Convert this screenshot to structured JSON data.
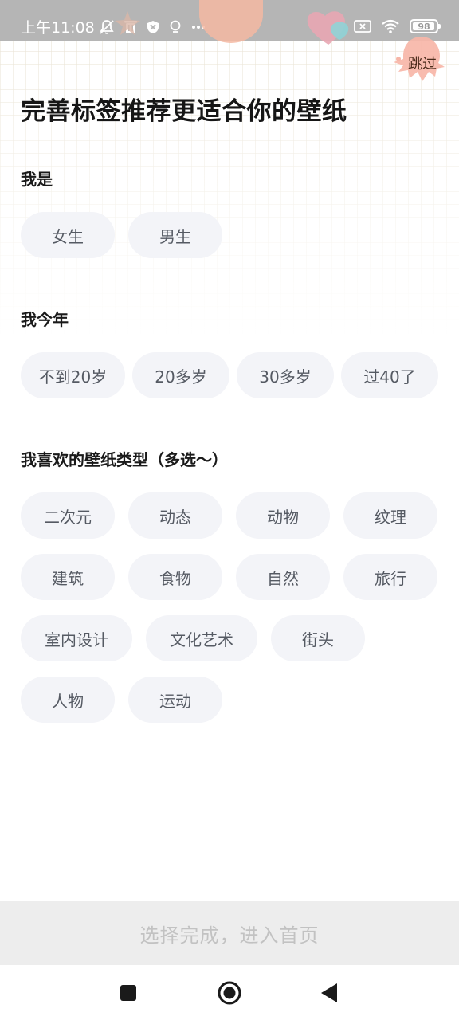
{
  "status_bar": {
    "time": "上午11:08",
    "battery": "98",
    "battery_level": 0.98,
    "icons_left": [
      "bell-off-icon",
      "trash-icon",
      "shield-icon",
      "location-icon",
      "more-dots-icon"
    ],
    "icons_right": [
      "sim-off-icon",
      "wifi-icon",
      "battery-icon"
    ]
  },
  "header": {
    "skip_label": "跳过",
    "title": "完善标签推荐更适合你的壁纸"
  },
  "sections": {
    "gender": {
      "title": "我是",
      "options": [
        "女生",
        "男生"
      ]
    },
    "age": {
      "title": "我今年",
      "options": [
        "不到20岁",
        "20多岁",
        "30多岁",
        "过40了"
      ]
    },
    "types": {
      "title": "我喜欢的壁纸类型（多选～）",
      "options": [
        "二次元",
        "动态",
        "动物",
        "纹理",
        "建筑",
        "食物",
        "自然",
        "旅行",
        "室内设计",
        "文化艺术",
        "街头",
        "人物",
        "运动"
      ]
    }
  },
  "footer": {
    "confirm_label": "选择完成，进入首页"
  },
  "colors": {
    "chip_bg": "#f3f4f8",
    "chip_text": "#555a63",
    "status_bar_bg": "#b5b5b5",
    "confirm_bg": "#ededed",
    "confirm_text": "#c2c2c2",
    "skip_bubble": "#f7b6a8"
  },
  "nav": {
    "icons": [
      "recent-apps-icon",
      "home-icon",
      "back-icon"
    ]
  }
}
